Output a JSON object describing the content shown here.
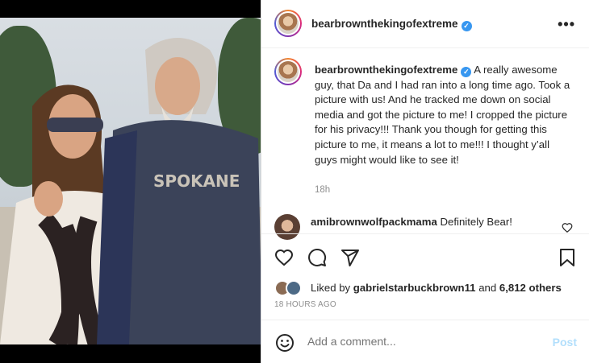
{
  "post": {
    "username": "bearbrownthekingofextreme",
    "more_label": "•••",
    "caption_user": "bearbrownthekingofextreme",
    "caption_text": "A really awesome guy, that Da and I had ran into a long time ago. Took a picture with us! And he tracked me down on social media and got the picture to me! I cropped the picture for his privacy!!! Thank you though for getting this picture to me, it means a lot to me!!! I thought y’all guys might would like to see it!",
    "caption_age": "18h"
  },
  "comment": {
    "user": "amibrownwolfpackmama",
    "text": "Definitely Bear!"
  },
  "likes": {
    "prefix": "Liked by",
    "user": "gabrielstarbuckbrown11",
    "and": "and",
    "count": "6,812 others"
  },
  "timestamp": "18 HOURS AGO",
  "add_comment": {
    "placeholder": "Add a comment...",
    "post_label": "Post"
  },
  "colors": {
    "verified": "#3897f0",
    "post_disabled": "#b2dffc"
  }
}
